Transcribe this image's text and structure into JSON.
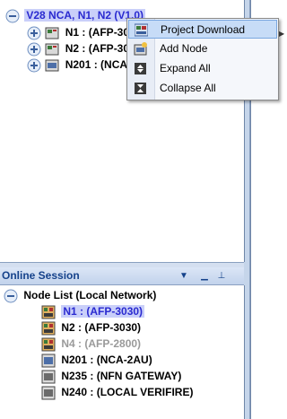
{
  "tree": {
    "root_label": "V28 NCA, N1, N2 (V1.0)",
    "nodes": [
      {
        "label": "N1 : (AFP-30"
      },
      {
        "label": "N2 : (AFP-30"
      },
      {
        "label": "N201 : (NCA"
      }
    ]
  },
  "context_menu": {
    "items": [
      {
        "label": "Project Download",
        "icon": "download-icon",
        "highlighted": true
      },
      {
        "label": "Add Node",
        "icon": "add-node-icon"
      },
      {
        "label": "Expand All",
        "icon": "expand-all-icon"
      },
      {
        "label": "Collapse All",
        "icon": "collapse-all-icon"
      }
    ]
  },
  "online_session": {
    "title": "Online Session",
    "list_label": "Node List (Local Network)",
    "nodes": [
      {
        "label": "N1 : (AFP-3030)",
        "state": "selected"
      },
      {
        "label": "N2 : (AFP-3030)",
        "state": "normal"
      },
      {
        "label": "N4 : (AFP-2800)",
        "state": "disabled"
      },
      {
        "label": "N201 : (NCA-2AU)",
        "state": "normal"
      },
      {
        "label": "N235 : (NFN GATEWAY)",
        "state": "normal"
      },
      {
        "label": "N240 : (LOCAL VERIFIRE)",
        "state": "normal"
      }
    ]
  },
  "colors": {
    "root_text": "#2a2ad0",
    "root_highlight": "#c9cff9",
    "menu_highlight": "#c7dcf7",
    "header_text": "#15428b",
    "disabled_text": "#9a9a9a"
  }
}
